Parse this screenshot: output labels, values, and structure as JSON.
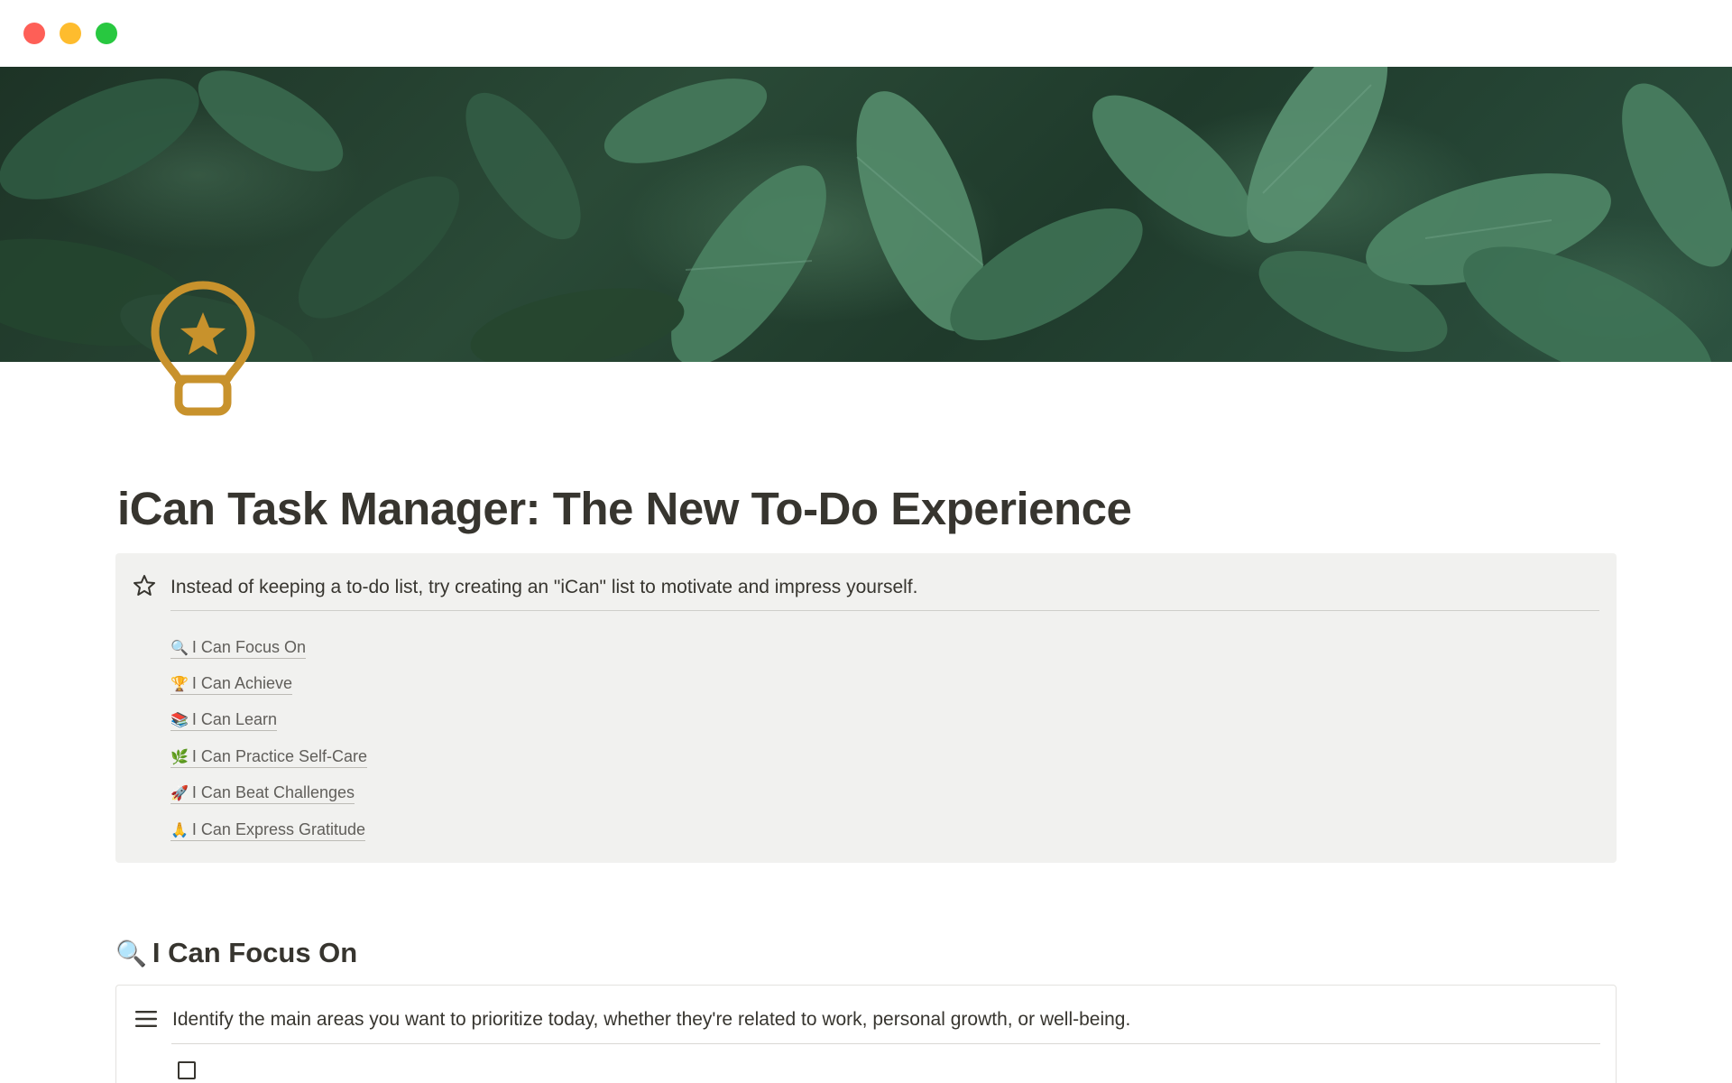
{
  "window": {
    "controls": [
      "close",
      "minimize",
      "maximize"
    ],
    "colors": {
      "close": "#fe5f57",
      "minimize": "#febc2e",
      "maximize": "#28c840"
    }
  },
  "cover": {
    "description_icon": "leaf-cover-image"
  },
  "page": {
    "icon": "lightbulb-star-icon",
    "icon_color": "#c8922c",
    "title": "iCan Task Manager: The New To-Do Experience"
  },
  "callout": {
    "icon": "star-outline-icon",
    "text": "Instead of keeping a to-do list, try creating an \"iCan\" list to motivate and impress yourself.",
    "links": [
      {
        "emoji": "🔍",
        "label": "I Can Focus On"
      },
      {
        "emoji": "🏆",
        "label": "I Can Achieve"
      },
      {
        "emoji": "📚",
        "label": "I Can Learn"
      },
      {
        "emoji": "🌿",
        "label": "I Can Practice Self-Care"
      },
      {
        "emoji": "🚀",
        "label": "I Can Beat Challenges"
      },
      {
        "emoji": "🙏",
        "label": "I Can Express Gratitude"
      }
    ]
  },
  "focus_section": {
    "emoji": "🔍",
    "heading": "I Can Focus On",
    "icon": "hamburger-menu-icon",
    "description": "Identify the main areas you want to prioritize today, whether they're related to work, personal growth, or well-being."
  }
}
